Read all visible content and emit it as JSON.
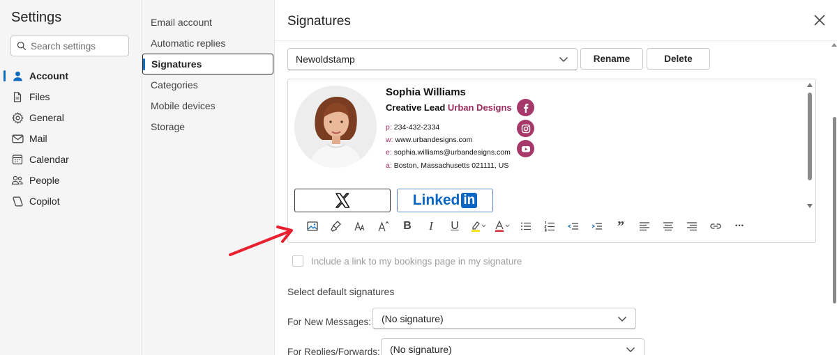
{
  "settings": {
    "title": "Settings",
    "search_placeholder": "Search settings",
    "nav": [
      {
        "label": "Account",
        "icon": "person-icon",
        "active": true
      },
      {
        "label": "Files",
        "icon": "file-icon"
      },
      {
        "label": "General",
        "icon": "gear-icon"
      },
      {
        "label": "Mail",
        "icon": "mail-icon"
      },
      {
        "label": "Calendar",
        "icon": "calendar-icon"
      },
      {
        "label": "People",
        "icon": "people-icon"
      },
      {
        "label": "Copilot",
        "icon": "copilot-icon"
      }
    ]
  },
  "account_menu": {
    "items": [
      "Email account",
      "Automatic replies",
      "Signatures",
      "Categories",
      "Mobile devices",
      "Storage"
    ],
    "active": "Signatures"
  },
  "signatures": {
    "title": "Signatures",
    "selected_signature": "Newoldstamp",
    "rename_label": "Rename",
    "delete_label": "Delete",
    "preview": {
      "name": "Sophia Williams",
      "role": "Creative Lead",
      "company": "Urban Designs",
      "phone_label": "p:",
      "phone": "234-432-2334",
      "web_label": "w:",
      "web": "www.urbandesigns.com",
      "email_label": "e:",
      "email": "sophia.williams@urbandesigns.com",
      "address_label": "a:",
      "address": "Boston, Massachusetts 021111, US",
      "badge_x": "X",
      "badge_linkedin_text": "Linked",
      "badge_linkedin_box": "in",
      "social_icons": [
        "facebook-icon",
        "instagram-icon",
        "youtube-icon"
      ],
      "accent_color": "#a6386a"
    },
    "toolbar_icons": [
      "insert-image-icon",
      "format-painter-icon",
      "font-size-icon",
      "grow-font-icon",
      "bold-icon",
      "italic-icon",
      "underline-icon",
      "highlight-icon",
      "font-color-icon",
      "bullets-icon",
      "numbering-icon",
      "decrease-indent-icon",
      "increase-indent-icon",
      "quote-icon",
      "align-left-icon",
      "align-center-icon",
      "align-right-icon",
      "link-icon",
      "more-icon"
    ],
    "bold_glyph": "B",
    "italic_glyph": "I",
    "underline_glyph": "U",
    "more_glyph": "···",
    "quote_glyph": "”",
    "bookings_link_label": "Include a link to my bookings page in my signature",
    "default_section_label": "Select default signatures",
    "new_messages_label": "For New Messages:",
    "new_messages_value": "(No signature)",
    "replies_label": "For Replies/Forwards:",
    "replies_value": "(No signature)"
  }
}
